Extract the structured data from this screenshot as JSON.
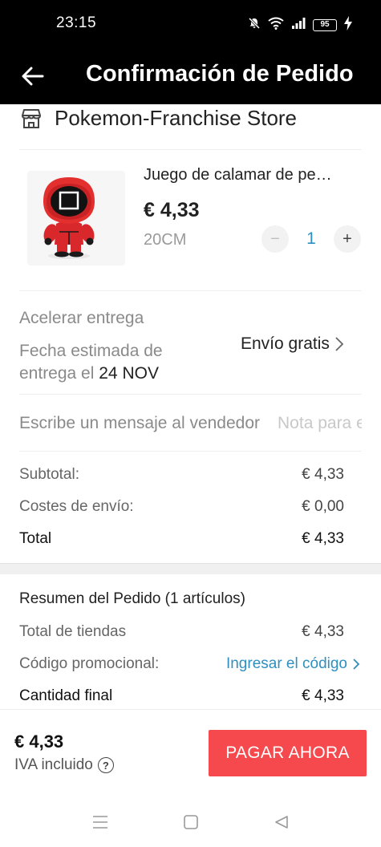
{
  "status_bar": {
    "time": "23:15",
    "battery": "95"
  },
  "header": {
    "title": "Confirmación de Pedido"
  },
  "store": {
    "name": "Pokemon-Franchise Store",
    "icon": "store-icon"
  },
  "product": {
    "title": "Juego de calamar de pe…",
    "price": "€ 4,33",
    "variant": "20CM",
    "quantity": "1",
    "minus_label": "−",
    "plus_label": "+"
  },
  "delivery": {
    "label": "Acelerar entrega",
    "date_label": "Fecha estimada de entrega el",
    "date_value": "24 NOV",
    "shipping_option": "Envío gratis"
  },
  "message": {
    "label": "Escribe un mensaje al vendedor",
    "placeholder": "Nota para el vendedor"
  },
  "store_totals": {
    "subtotal_label": "Subtotal:",
    "subtotal_value": "€ 4,33",
    "shipping_label": "Costes de envío:",
    "shipping_value": "€ 0,00",
    "total_label": "Total",
    "total_value": "€ 4,33"
  },
  "order_summary": {
    "title": "Resumen del Pedido (1 artículos)",
    "stores_total_label": "Total de tiendas",
    "stores_total_value": "€ 4,33",
    "promo_label": "Código promocional:",
    "promo_link": "Ingresar el código",
    "final_label": "Cantidad final",
    "final_value": "€ 4,33"
  },
  "bottom_bar": {
    "total": "€ 4,33",
    "vat_label": "IVA incluido",
    "help_glyph": "?",
    "pay_button": "PAGAR AHORA"
  },
  "colors": {
    "header_bg": "#000000",
    "accent_link": "#2f8fbf",
    "pay_button": "#f5494e"
  }
}
